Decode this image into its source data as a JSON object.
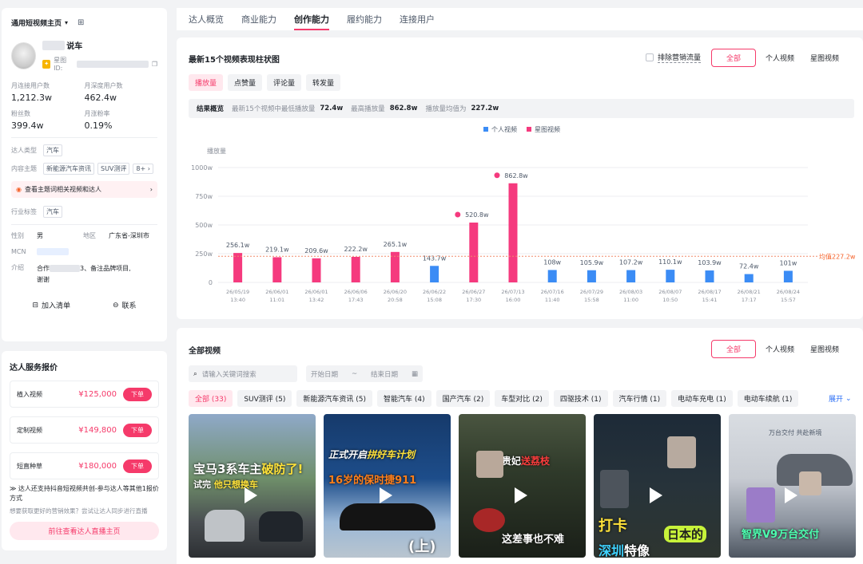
{
  "profile": {
    "platform_select": "通用短视频主页",
    "name_suffix": "说车",
    "id_label": "星图ID:",
    "stats": [
      {
        "label": "月连接用户数",
        "value": "1,212.3w"
      },
      {
        "label": "月深度用户数",
        "value": "462.4w"
      },
      {
        "label": "粉丝数",
        "value": "399.4w"
      },
      {
        "label": "月涨粉率",
        "value": "0.19%"
      }
    ],
    "type_label": "达人类型",
    "type_tag": "汽车",
    "topic_label": "内容主题",
    "topic_tags": [
      "新能源汽车资讯",
      "SUV测评"
    ],
    "topic_more": "8+",
    "topic_banner": "查看主题词相关视频和达人",
    "industry_label": "行业标签",
    "industry_tag": "汽车",
    "gender_label": "性别",
    "gender": "男",
    "region_label": "地区",
    "region": "广东省-深圳市",
    "mcn_label": "MCN",
    "intro_label": "介绍",
    "intro_a": "合作",
    "intro_b": "3、备注品牌项目,",
    "intro_c": "谢谢",
    "add_list": "加入清单",
    "contact": "联系"
  },
  "pricing": {
    "title": "达人服务报价",
    "items": [
      {
        "name": "植入视频",
        "price": "¥125,000",
        "action": "下单"
      },
      {
        "name": "定制视频",
        "price": "¥149,800",
        "action": "下单"
      },
      {
        "name": "短直种草",
        "price": "¥180,000",
        "action": "下单"
      }
    ],
    "note": "达人还支持抖音短视频共创-参与达人等其他1报价方式",
    "hint": "想要获取更好的营销效果？尝试让达人同步进行直播",
    "live_button": "前往查看达人直播主页"
  },
  "tabs": [
    "达人概览",
    "商业能力",
    "创作能力",
    "履约能力",
    "连接用户"
  ],
  "active_tab": 2,
  "chart_section": {
    "title": "最新15个视频表现柱状图",
    "exclude_label": "排除营销流量",
    "filters": [
      "全部",
      "个人视频",
      "星图视频"
    ],
    "metrics": [
      "播放量",
      "点赞量",
      "评论量",
      "转发量"
    ],
    "summary_label": "结果概览",
    "summary_a": "最新15个视频中最低播放量",
    "summary_a_val": "72.4w",
    "summary_b": "最高播放量",
    "summary_b_val": "862.8w",
    "summary_c": "播放量均值为",
    "summary_c_val": "227.2w"
  },
  "chart_data": {
    "type": "bar",
    "ylabel": "播放量",
    "ylim": [
      0,
      1000
    ],
    "yticks": [
      "0",
      "250w",
      "500w",
      "750w",
      "1000w"
    ],
    "series": [
      {
        "name": "个人视频",
        "color": "#3b8cf5"
      },
      {
        "name": "星图视频",
        "color": "#f53a7e"
      }
    ],
    "average": {
      "value": 227.2,
      "label": "均值227.2w"
    },
    "bars": [
      {
        "date": "26/05/19",
        "time": "13:40",
        "value": 256.1,
        "label": "256.1w",
        "series": 1
      },
      {
        "date": "26/06/01",
        "time": "11:01",
        "value": 219.1,
        "label": "219.1w",
        "series": 1
      },
      {
        "date": "26/06/01",
        "time": "13:42",
        "value": 209.6,
        "label": "209.6w",
        "series": 1
      },
      {
        "date": "26/06/06",
        "time": "17:43",
        "value": 222.2,
        "label": "222.2w",
        "series": 1
      },
      {
        "date": "26/06/20",
        "time": "20:58",
        "value": 265.1,
        "label": "265.1w",
        "series": 1
      },
      {
        "date": "26/06/22",
        "time": "15:08",
        "value": 143.7,
        "label": "143.7w",
        "series": 0
      },
      {
        "date": "26/06/27",
        "time": "17:30",
        "value": 520.8,
        "label": "520.8w",
        "series": 1,
        "peak": true
      },
      {
        "date": "26/07/13",
        "time": "16:00",
        "value": 862.8,
        "label": "862.8w",
        "series": 1,
        "peak": true
      },
      {
        "date": "26/07/16",
        "time": "11:40",
        "value": 108,
        "label": "108w",
        "series": 0
      },
      {
        "date": "26/07/29",
        "time": "15:58",
        "value": 105.9,
        "label": "105.9w",
        "series": 0
      },
      {
        "date": "26/08/03",
        "time": "11:00",
        "value": 107.2,
        "label": "107.2w",
        "series": 0
      },
      {
        "date": "26/08/07",
        "time": "10:50",
        "value": 110.1,
        "label": "110.1w",
        "series": 0
      },
      {
        "date": "26/08/17",
        "time": "15:41",
        "value": 103.9,
        "label": "103.9w",
        "series": 0
      },
      {
        "date": "26/08/21",
        "time": "17:17",
        "value": 72.4,
        "label": "72.4w",
        "series": 0
      },
      {
        "date": "26/08/24",
        "time": "15:57",
        "value": 101,
        "label": "101w",
        "series": 0
      }
    ]
  },
  "videos": {
    "title": "全部视频",
    "filters": [
      "全部",
      "个人视频",
      "星图视频"
    ],
    "search_placeholder": "请输入关键词搜索",
    "start_date": "开始日期",
    "tilde": "~",
    "end_date": "结束日期",
    "categories": [
      "全部 (33)",
      "SUV测评 (5)",
      "新能源汽车资讯 (5)",
      "智能汽车 (4)",
      "国产汽车 (2)",
      "车型对比 (2)",
      "四驱技术 (1)",
      "汽车行情 (1)",
      "电动车充电 (1)",
      "电动车续航 (1)"
    ],
    "expand": "展开",
    "thumbs": [
      {
        "line1": "宝马3系车主",
        "line1b": "破防了!",
        "line2": "试完",
        "line2b": "他只想换车"
      },
      {
        "line1": "正式开启",
        "line1b": "拼好车计划",
        "line2": "16岁的保时捷911",
        "line3": "(上)"
      },
      {
        "line1": "杨贵妃",
        "line1b": "送荔枝",
        "line2": "这差事也不难"
      },
      {
        "line1": "打卡",
        "line1b": "日本的",
        "line2": "深圳",
        "line2b": "特像"
      },
      {
        "line1": "万台交付 共赴新境",
        "line2": "智界V9万台交付"
      }
    ]
  }
}
